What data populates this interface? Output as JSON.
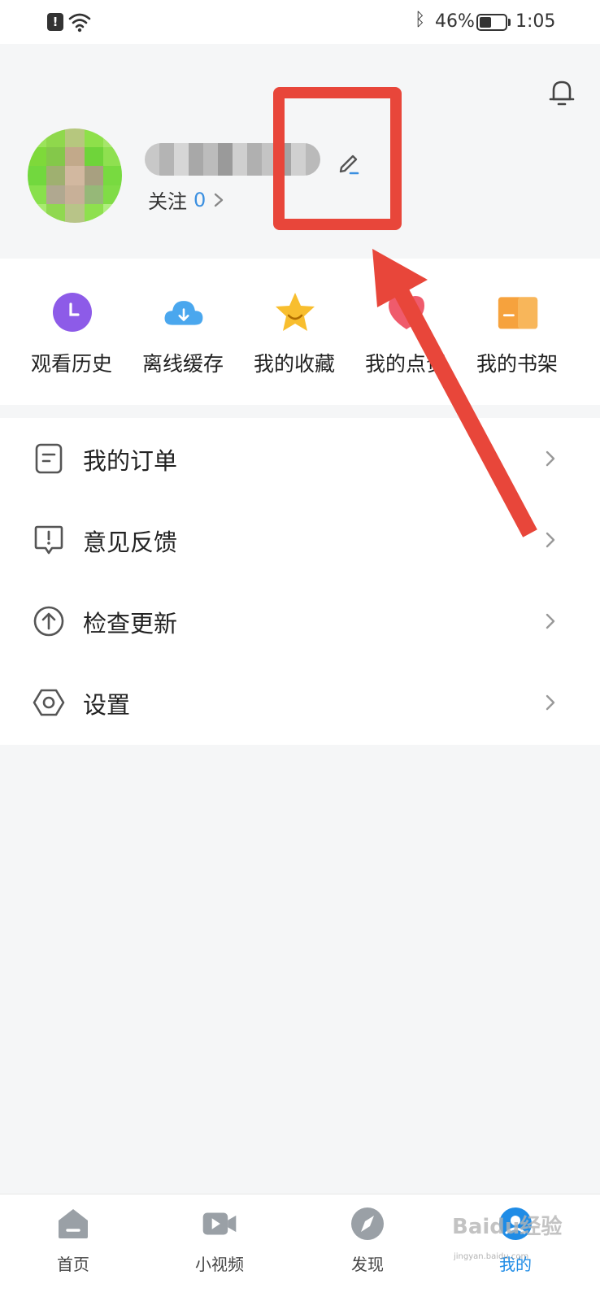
{
  "status_bar": {
    "alert": "!",
    "battery_percent_label": "46%",
    "battery_level": 0.46,
    "time": "1:05"
  },
  "header": {
    "follow_label": "关注",
    "follow_count": "0"
  },
  "quick_actions": [
    {
      "label": "观看历史",
      "icon": "clock-icon",
      "color": "#8d5be8"
    },
    {
      "label": "离线缓存",
      "icon": "cloud-download-icon",
      "color": "#4aa7ee"
    },
    {
      "label": "我的收藏",
      "icon": "star-icon",
      "color": "#f8be2e"
    },
    {
      "label": "我的点赞",
      "icon": "heart-icon",
      "color": "#ef5b6c"
    },
    {
      "label": "我的书架",
      "icon": "book-icon",
      "color": "#f6a23d"
    }
  ],
  "menu": [
    {
      "label": "我的订单",
      "icon": "order-icon"
    },
    {
      "label": "意见反馈",
      "icon": "feedback-icon"
    },
    {
      "label": "检查更新",
      "icon": "update-icon"
    },
    {
      "label": "设置",
      "icon": "settings-icon"
    }
  ],
  "bottom_nav": [
    {
      "label": "首页",
      "icon": "home-icon",
      "active": false
    },
    {
      "label": "小视频",
      "icon": "video-icon",
      "active": false
    },
    {
      "label": "发现",
      "icon": "compass-icon",
      "active": false
    },
    {
      "label": "我的",
      "icon": "profile-icon",
      "active": true
    }
  ],
  "watermark": {
    "text": "Baidu经验",
    "sub": "jingyan.baidu.com"
  },
  "colors": {
    "accent": "#1f8ce6",
    "annotation_red": "#e8463a",
    "follow_count": "#3a8fe0"
  }
}
